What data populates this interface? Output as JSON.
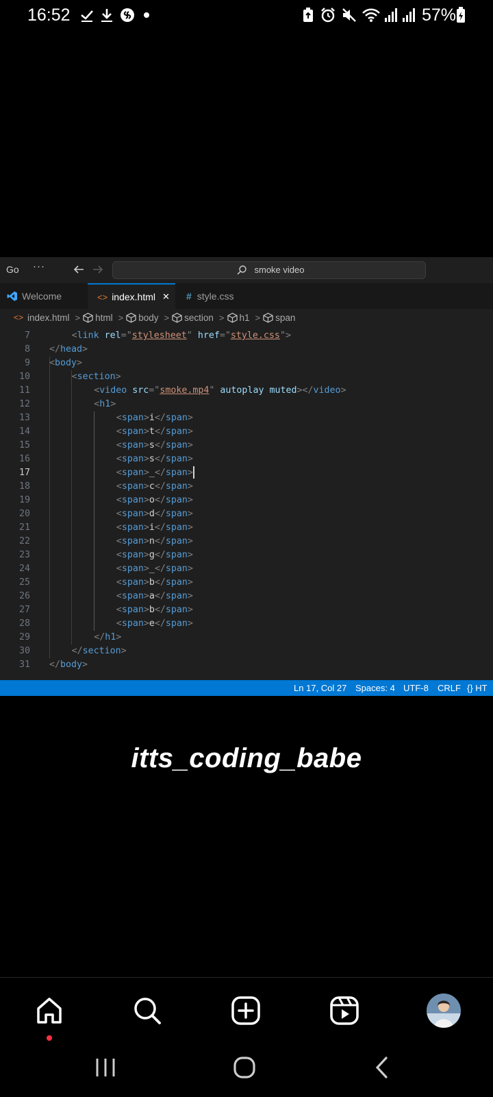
{
  "status_bar": {
    "time": "16:52",
    "battery": "57%",
    "left_icons": [
      "check-icon",
      "download-icon",
      "shazam-icon",
      "dot-icon"
    ],
    "right_icons": [
      "battery-saver-icon",
      "alarm-icon",
      "mute-icon",
      "wifi-icon",
      "signal-icon",
      "signal-icon-2",
      "battery-charging-icon"
    ]
  },
  "vscode": {
    "menu": {
      "go": "Go",
      "more": "···"
    },
    "search": {
      "text": "smoke video"
    },
    "tabs": [
      {
        "label": "Welcome",
        "icon": "vscode-icon"
      },
      {
        "label": "index.html",
        "icon": "html-icon",
        "active": true,
        "close": "✕"
      },
      {
        "label": "style.css",
        "icon": "css-hash-icon",
        "hash": "#"
      }
    ],
    "breadcrumb": [
      "index.html",
      "html",
      "body",
      "section",
      "h1",
      "span"
    ],
    "code_lines": [
      {
        "n": "7",
        "indent": 1,
        "parts": [
          [
            "t",
            "<"
          ],
          [
            "tn",
            "link"
          ],
          [
            "txt",
            " "
          ],
          [
            "an",
            "rel"
          ],
          [
            "t",
            "="
          ],
          [
            "t",
            "\""
          ],
          [
            "av",
            "stylesheet"
          ],
          [
            "t",
            "\""
          ],
          [
            "txt",
            " "
          ],
          [
            "an",
            "href"
          ],
          [
            "t",
            "="
          ],
          [
            "t",
            "\""
          ],
          [
            "av",
            "style.css"
          ],
          [
            "t",
            "\">"
          ]
        ]
      },
      {
        "n": "8",
        "indent": 0,
        "parts": [
          [
            "t",
            "</"
          ],
          [
            "tn",
            "head"
          ],
          [
            "t",
            ">"
          ]
        ]
      },
      {
        "n": "9",
        "indent": 0,
        "parts": [
          [
            "t",
            "<"
          ],
          [
            "tn",
            "body"
          ],
          [
            "t",
            ">"
          ]
        ]
      },
      {
        "n": "10",
        "indent": 1,
        "parts": [
          [
            "t",
            "<"
          ],
          [
            "tn",
            "section"
          ],
          [
            "t",
            ">"
          ]
        ]
      },
      {
        "n": "11",
        "indent": 2,
        "parts": [
          [
            "t",
            "<"
          ],
          [
            "tn",
            "video"
          ],
          [
            "txt",
            " "
          ],
          [
            "an",
            "src"
          ],
          [
            "t",
            "="
          ],
          [
            "t",
            "\""
          ],
          [
            "av",
            "smoke.mp4"
          ],
          [
            "t",
            "\""
          ],
          [
            "txt",
            " "
          ],
          [
            "an",
            "autoplay"
          ],
          [
            "txt",
            " "
          ],
          [
            "an",
            "muted"
          ],
          [
            "t",
            "></"
          ],
          [
            "tn",
            "video"
          ],
          [
            "t",
            ">"
          ]
        ]
      },
      {
        "n": "12",
        "indent": 2,
        "parts": [
          [
            "t",
            "<"
          ],
          [
            "tn",
            "h1"
          ],
          [
            "t",
            ">"
          ]
        ]
      },
      {
        "n": "13",
        "indent": 3,
        "parts": [
          [
            "t",
            "<"
          ],
          [
            "tn",
            "span"
          ],
          [
            "t",
            ">"
          ],
          [
            "txt",
            "i"
          ],
          [
            "t",
            "</"
          ],
          [
            "tn",
            "span"
          ],
          [
            "t",
            ">"
          ]
        ]
      },
      {
        "n": "14",
        "indent": 3,
        "parts": [
          [
            "t",
            "<"
          ],
          [
            "tn",
            "span"
          ],
          [
            "t",
            ">"
          ],
          [
            "txt",
            "t"
          ],
          [
            "t",
            "</"
          ],
          [
            "tn",
            "span"
          ],
          [
            "t",
            ">"
          ]
        ]
      },
      {
        "n": "15",
        "indent": 3,
        "parts": [
          [
            "t",
            "<"
          ],
          [
            "tn",
            "span"
          ],
          [
            "t",
            ">"
          ],
          [
            "txt",
            "s"
          ],
          [
            "t",
            "</"
          ],
          [
            "tn",
            "span"
          ],
          [
            "t",
            ">"
          ]
        ]
      },
      {
        "n": "16",
        "indent": 3,
        "parts": [
          [
            "t",
            "<"
          ],
          [
            "tn",
            "span"
          ],
          [
            "t",
            ">"
          ],
          [
            "txt",
            "s"
          ],
          [
            "t",
            "</"
          ],
          [
            "tn",
            "span"
          ],
          [
            "t",
            ">"
          ]
        ]
      },
      {
        "n": "17",
        "indent": 3,
        "active": true,
        "parts": [
          [
            "t",
            "<"
          ],
          [
            "tn",
            "span"
          ],
          [
            "t",
            ">"
          ],
          [
            "txt",
            "_"
          ],
          [
            "t",
            "</"
          ],
          [
            "tn",
            "span"
          ],
          [
            "t",
            ">"
          ]
        ]
      },
      {
        "n": "18",
        "indent": 3,
        "parts": [
          [
            "t",
            "<"
          ],
          [
            "tn",
            "span"
          ],
          [
            "t",
            ">"
          ],
          [
            "txt",
            "c"
          ],
          [
            "t",
            "</"
          ],
          [
            "tn",
            "span"
          ],
          [
            "t",
            ">"
          ]
        ]
      },
      {
        "n": "19",
        "indent": 3,
        "parts": [
          [
            "t",
            "<"
          ],
          [
            "tn",
            "span"
          ],
          [
            "t",
            ">"
          ],
          [
            "txt",
            "o"
          ],
          [
            "t",
            "</"
          ],
          [
            "tn",
            "span"
          ],
          [
            "t",
            ">"
          ]
        ]
      },
      {
        "n": "20",
        "indent": 3,
        "parts": [
          [
            "t",
            "<"
          ],
          [
            "tn",
            "span"
          ],
          [
            "t",
            ">"
          ],
          [
            "txt",
            "d"
          ],
          [
            "t",
            "</"
          ],
          [
            "tn",
            "span"
          ],
          [
            "t",
            ">"
          ]
        ]
      },
      {
        "n": "21",
        "indent": 3,
        "parts": [
          [
            "t",
            "<"
          ],
          [
            "tn",
            "span"
          ],
          [
            "t",
            ">"
          ],
          [
            "txt",
            "i"
          ],
          [
            "t",
            "</"
          ],
          [
            "tn",
            "span"
          ],
          [
            "t",
            ">"
          ]
        ]
      },
      {
        "n": "22",
        "indent": 3,
        "parts": [
          [
            "t",
            "<"
          ],
          [
            "tn",
            "span"
          ],
          [
            "t",
            ">"
          ],
          [
            "txt",
            "n"
          ],
          [
            "t",
            "</"
          ],
          [
            "tn",
            "span"
          ],
          [
            "t",
            ">"
          ]
        ]
      },
      {
        "n": "23",
        "indent": 3,
        "parts": [
          [
            "t",
            "<"
          ],
          [
            "tn",
            "span"
          ],
          [
            "t",
            ">"
          ],
          [
            "txt",
            "g"
          ],
          [
            "t",
            "</"
          ],
          [
            "tn",
            "span"
          ],
          [
            "t",
            ">"
          ]
        ]
      },
      {
        "n": "24",
        "indent": 3,
        "parts": [
          [
            "t",
            "<"
          ],
          [
            "tn",
            "span"
          ],
          [
            "t",
            ">"
          ],
          [
            "txt",
            "_"
          ],
          [
            "t",
            "</"
          ],
          [
            "tn",
            "span"
          ],
          [
            "t",
            ">"
          ]
        ]
      },
      {
        "n": "25",
        "indent": 3,
        "parts": [
          [
            "t",
            "<"
          ],
          [
            "tn",
            "span"
          ],
          [
            "t",
            ">"
          ],
          [
            "txt",
            "b"
          ],
          [
            "t",
            "</"
          ],
          [
            "tn",
            "span"
          ],
          [
            "t",
            ">"
          ]
        ]
      },
      {
        "n": "26",
        "indent": 3,
        "parts": [
          [
            "t",
            "<"
          ],
          [
            "tn",
            "span"
          ],
          [
            "t",
            ">"
          ],
          [
            "txt",
            "a"
          ],
          [
            "t",
            "</"
          ],
          [
            "tn",
            "span"
          ],
          [
            "t",
            ">"
          ]
        ]
      },
      {
        "n": "27",
        "indent": 3,
        "parts": [
          [
            "t",
            "<"
          ],
          [
            "tn",
            "span"
          ],
          [
            "t",
            ">"
          ],
          [
            "txt",
            "b"
          ],
          [
            "t",
            "</"
          ],
          [
            "tn",
            "span"
          ],
          [
            "t",
            ">"
          ]
        ]
      },
      {
        "n": "28",
        "indent": 3,
        "parts": [
          [
            "t",
            "<"
          ],
          [
            "tn",
            "span"
          ],
          [
            "t",
            ">"
          ],
          [
            "txt",
            "e"
          ],
          [
            "t",
            "</"
          ],
          [
            "tn",
            "span"
          ],
          [
            "t",
            ">"
          ]
        ]
      },
      {
        "n": "29",
        "indent": 2,
        "parts": [
          [
            "t",
            "</"
          ],
          [
            "tn",
            "h1"
          ],
          [
            "t",
            ">"
          ]
        ]
      },
      {
        "n": "30",
        "indent": 1,
        "parts": [
          [
            "t",
            "</"
          ],
          [
            "tn",
            "section"
          ],
          [
            "t",
            ">"
          ]
        ]
      },
      {
        "n": "31",
        "indent": 0,
        "parts": [
          [
            "t",
            "</"
          ],
          [
            "tn",
            "body"
          ],
          [
            "t",
            ">"
          ]
        ]
      }
    ],
    "status": {
      "position": "Ln 17, Col 27",
      "spaces": "Spaces: 4",
      "encoding": "UTF-8",
      "eol": "CRLF",
      "language": "{} HT"
    },
    "colors": {
      "accent": "#0078d4",
      "editor_bg": "#1f1f1f",
      "tag": "#569cd6",
      "attr": "#9cdcfe",
      "string": "#ce9178"
    }
  },
  "watermark": "itts_coding_babe",
  "bottom_nav": {
    "items": [
      "home-icon",
      "search-icon",
      "create-icon",
      "reels-icon",
      "profile-avatar"
    ],
    "notification_dot_color": "#ff3040"
  },
  "system_nav": [
    "recent-apps-icon",
    "home-button-icon",
    "back-icon"
  ]
}
